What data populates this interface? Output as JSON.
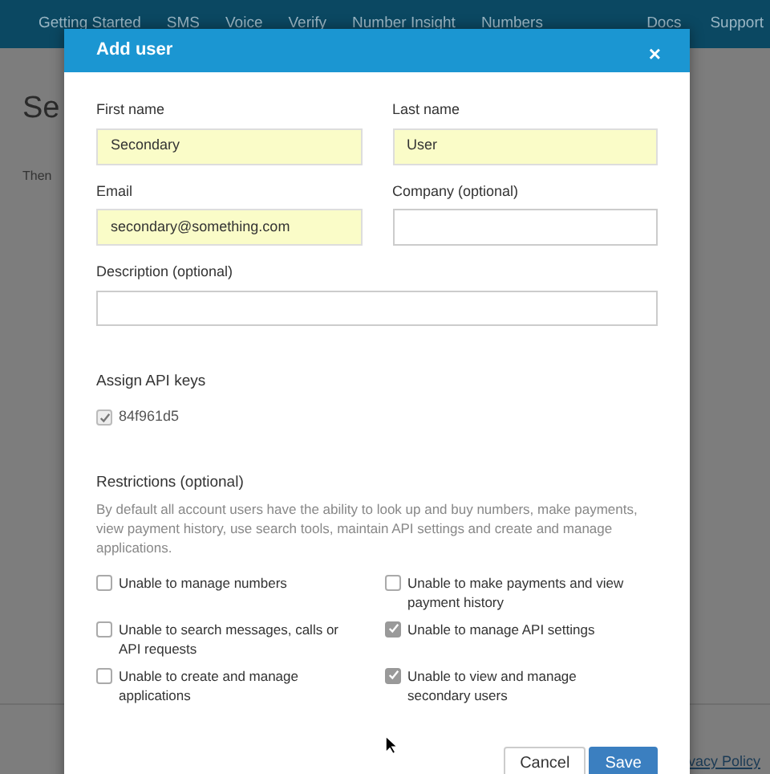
{
  "nav": {
    "items": [
      {
        "label": "Getting Started"
      },
      {
        "label": "SMS"
      },
      {
        "label": "Voice"
      },
      {
        "label": "Verify"
      },
      {
        "label": "Number Insight"
      },
      {
        "label": "Numbers"
      }
    ],
    "right_items": [
      {
        "label": "Docs"
      },
      {
        "label": "Support"
      }
    ]
  },
  "background": {
    "heading": "Se",
    "text": "Then",
    "footer_link": "vacy Policy"
  },
  "dialog": {
    "title": "Add user",
    "close": "×",
    "fields": [
      {
        "label": "First name",
        "value": "Secondary",
        "autofilled": true
      },
      {
        "label": "Last name",
        "value": "User",
        "autofilled": true
      },
      {
        "label": "Email",
        "value": "secondary@something.com",
        "autofilled": true
      },
      {
        "label": "Company (optional)",
        "autofilled": false
      }
    ],
    "description": {
      "label": "Description (optional)"
    },
    "api_keys": {
      "label": "Assign API keys",
      "keys": [
        {
          "label": "84f961d5",
          "checked": true,
          "disabled": true
        }
      ]
    },
    "restrictions": {
      "label": "Restrictions (optional)",
      "help": "By default all account users have the ability to look up and buy numbers, make payments, view payment history, use search tools, maintain API settings and create and manage applications.",
      "options": [
        {
          "label": "Unable to manage numbers",
          "checked": false
        },
        {
          "label": "Unable to make payments and view payment history",
          "checked": false
        },
        {
          "label": "Unable to search messages, calls or API requests",
          "checked": false
        },
        {
          "label": "Unable to manage API settings",
          "checked": true
        },
        {
          "label": "Unable to create and manage applications",
          "checked": false
        },
        {
          "label": "Unable to view and manage secondary users",
          "checked": true
        }
      ]
    },
    "buttons": [
      {
        "label": "Cancel",
        "kind": "secondary"
      },
      {
        "label": "Save",
        "kind": "primary"
      }
    ]
  }
}
